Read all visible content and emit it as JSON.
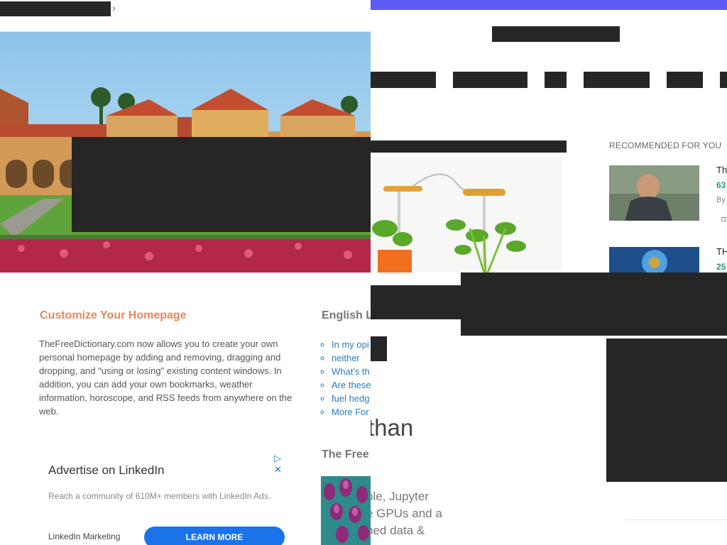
{
  "left": {
    "header": {
      "chevron": "›"
    },
    "customize": {
      "title": "Customize Your Homepage",
      "body": "TheFreeDictionary.com now allows you to create your own personal homepage by adding and removing, dragging and dropping, and \"using or losing\" existing content windows. In addition, you can add your own bookmarks, weather information, horoscope, and RSS feeds from anywhere on the web."
    },
    "english": {
      "title": "English L",
      "links": [
        "In my opi",
        "neither",
        "What's th",
        "Are these",
        "fuel hedg",
        "More For"
      ]
    },
    "free_title": "The Free",
    "ad": {
      "title": "Advertise on LinkedIn",
      "text": "Reach a community of 610M+ members with LinkedIn Ads.",
      "brand": "LinkedIn Marketing",
      "button": "LEARN MORE",
      "icons": "▷ ✕"
    }
  },
  "right": {
    "accent": "#5c5cf5",
    "recommended_title": "RECOMMENDED FOR YOU",
    "items": [
      {
        "title": "Th",
        "num": "63",
        "by": "By"
      },
      {
        "title": "TH",
        "num": "25"
      }
    ],
    "big_text": "than",
    "para_lines": [
      "ble, Jupyter",
      "e GPUs and a",
      "hed data &"
    ]
  }
}
